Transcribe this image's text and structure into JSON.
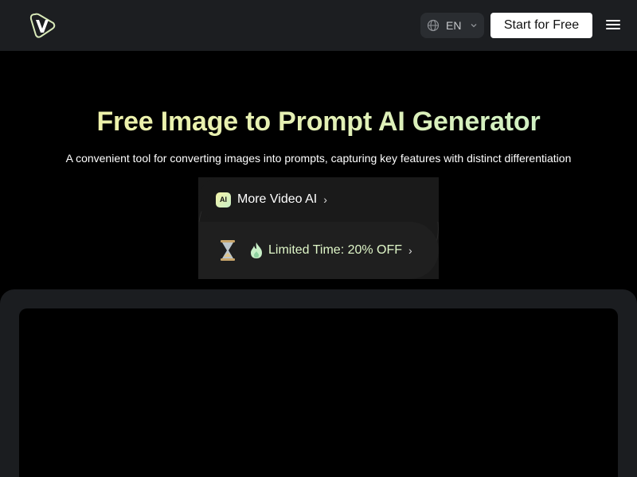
{
  "header": {
    "logo_icon": "v-logo-icon",
    "language": {
      "code": "EN",
      "icon": "globe-icon"
    },
    "start_label": "Start for Free",
    "menu_icon": "hamburger-menu-icon"
  },
  "hero": {
    "title": "Free Image to Prompt AI Generator",
    "subtitle": "A convenient tool for converting images into prompts, capturing key features with distinct differentiation"
  },
  "promos": {
    "video": {
      "badge": "AI",
      "label": "More Video AI",
      "arrow": "›"
    },
    "deal": {
      "label": "Limited Time: 20% OFF",
      "arrow": "›",
      "icons": [
        "hourglass-icon",
        "flame-icon"
      ]
    }
  },
  "colors": {
    "header_bg": "#1c1e21",
    "accent_gradient": [
      "#f2f2a6",
      "#c7f0c9"
    ],
    "button_bg": "#ffffff",
    "page_bg": "#000000"
  }
}
